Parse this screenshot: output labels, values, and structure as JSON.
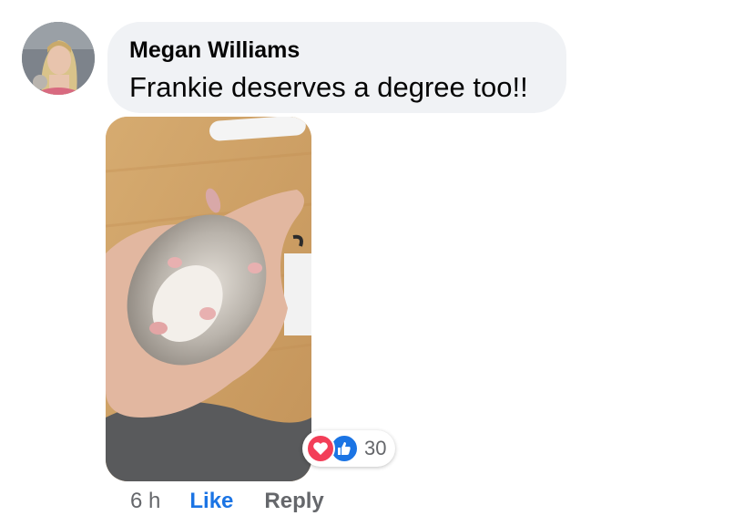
{
  "comment": {
    "author": "Megan Williams",
    "text": "Frankie deserves a degree too!!",
    "avatar_icon": "profile-photo",
    "photo_icon": "hamster-in-hand-photo"
  },
  "reactions": {
    "icons": [
      "heart-reaction-icon",
      "thumbs-up-reaction-icon"
    ],
    "count": "30",
    "colors": {
      "love": "#f33e58",
      "like": "#1b74e4"
    }
  },
  "actions": {
    "time": "6 h",
    "like_label": "Like",
    "reply_label": "Reply"
  },
  "colors": {
    "bubble": "#f0f2f5",
    "meta": "#65676b",
    "accent": "#1b74e4"
  }
}
